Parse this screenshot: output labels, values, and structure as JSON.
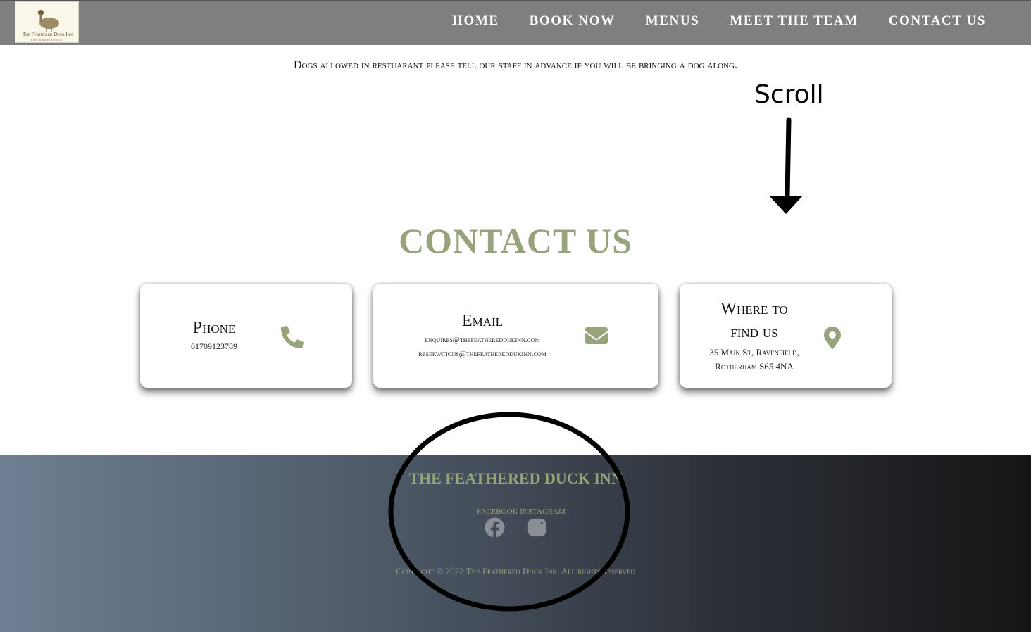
{
  "header": {
    "logo_name": "The Feathered Duck Inn",
    "logo_sub": "BAR & RESTAURANT",
    "nav": [
      "HOME",
      "BOOK NOW",
      "MENUS",
      "MEET THE TEAM",
      "CONTACT US"
    ]
  },
  "notice": "Dogs allowed in restuarant please tell our staff in advance if you will be bringing a dog along.",
  "annotation": {
    "scroll_label": "Scroll"
  },
  "contact": {
    "heading": "CONTACT US",
    "phone": {
      "title": "Phone",
      "number": "01709123789",
      "icon": "phone-icon"
    },
    "email": {
      "title": "Email",
      "enquiries": "enquires@thefeathereddukinn.com",
      "reservations": "reservations@thefeathereddukinn.com",
      "icon": "envelope-icon"
    },
    "location": {
      "title_line1": "Where to",
      "title_line2": "find us",
      "address_line1": "35 Main St, Ravenfield,",
      "address_line2": "Rotherham S65 4NA",
      "icon": "map-pin-icon"
    }
  },
  "footer": {
    "title": "THE FEATHERED DUCK INN",
    "social_labels": "FACEBOOK INSTAGRAM",
    "facebook_icon": "facebook-icon",
    "instagram_icon": "instagram-icon",
    "copyright": "Copyright © 2022 The Feathered Duck Inn. All rights reserved"
  },
  "colors": {
    "header_bg": "#7f7f7f",
    "accent_sage": "#97a37a",
    "footer_gradient_start": "#6e7f93",
    "footer_gradient_end": "#151515"
  }
}
